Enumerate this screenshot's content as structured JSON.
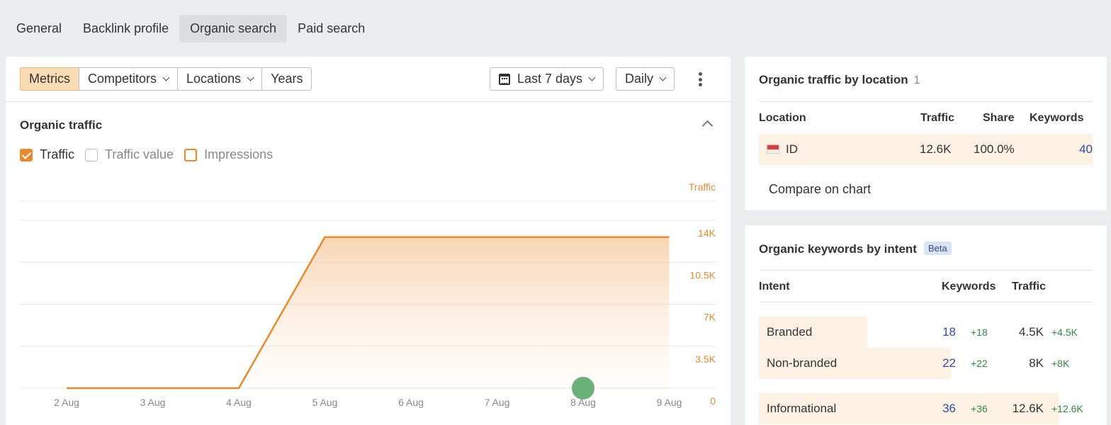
{
  "tabs": [
    "General",
    "Backlink profile",
    "Organic search",
    "Paid search"
  ],
  "toolbar": {
    "segments": [
      "Metrics",
      "Competitors",
      "Locations",
      "Years"
    ],
    "date_range": "Last 7 days",
    "interval": "Daily"
  },
  "organic_traffic": {
    "title": "Organic traffic",
    "checks": [
      {
        "label": "Traffic",
        "checked": true
      },
      {
        "label": "Traffic value",
        "checked": false
      },
      {
        "label": "Impressions",
        "checked": false
      }
    ]
  },
  "chart_data": {
    "type": "area",
    "title": "",
    "ylabel": "Traffic",
    "x": [
      "2 Aug",
      "3 Aug",
      "4 Aug",
      "5 Aug",
      "6 Aug",
      "7 Aug",
      "8 Aug",
      "9 Aug"
    ],
    "series": [
      {
        "name": "Traffic",
        "values": [
          0,
          0,
          0,
          12600,
          12600,
          12600,
          12600,
          12600
        ]
      }
    ],
    "yticks": [
      "0",
      "3.5K",
      "7K",
      "10.5K",
      "14K"
    ],
    "ytick_values": [
      0,
      3500,
      7000,
      10500,
      14000
    ],
    "ylim": [
      0,
      15600
    ],
    "grid": true,
    "color": "#e8892e",
    "marker": {
      "x": "8 Aug",
      "color": "#5aa86a"
    }
  },
  "location": {
    "title": "Organic traffic by location",
    "count": "1",
    "headers": [
      "Location",
      "Traffic",
      "Share",
      "Keywords"
    ],
    "rows": [
      {
        "code": "ID",
        "traffic": "12.6K",
        "share": "100.0%",
        "keywords": "40"
      }
    ],
    "compare": "Compare on chart"
  },
  "intent": {
    "title": "Organic keywords by intent",
    "badge": "Beta",
    "headers": [
      "Intent",
      "Keywords",
      "Traffic"
    ],
    "rows": [
      {
        "label": "Branded",
        "keywords": "18",
        "kw_delta": "+18",
        "traffic": "4.5K",
        "tr_delta": "+4.5K",
        "share": 0.36
      },
      {
        "label": "Non-branded",
        "keywords": "22",
        "kw_delta": "+22",
        "traffic": "8K",
        "tr_delta": "+8K",
        "share": 0.64
      },
      {
        "label": "Informational",
        "keywords": "36",
        "kw_delta": "+36",
        "traffic": "12.6K",
        "tr_delta": "+12.6K",
        "share": 1.0
      }
    ]
  }
}
